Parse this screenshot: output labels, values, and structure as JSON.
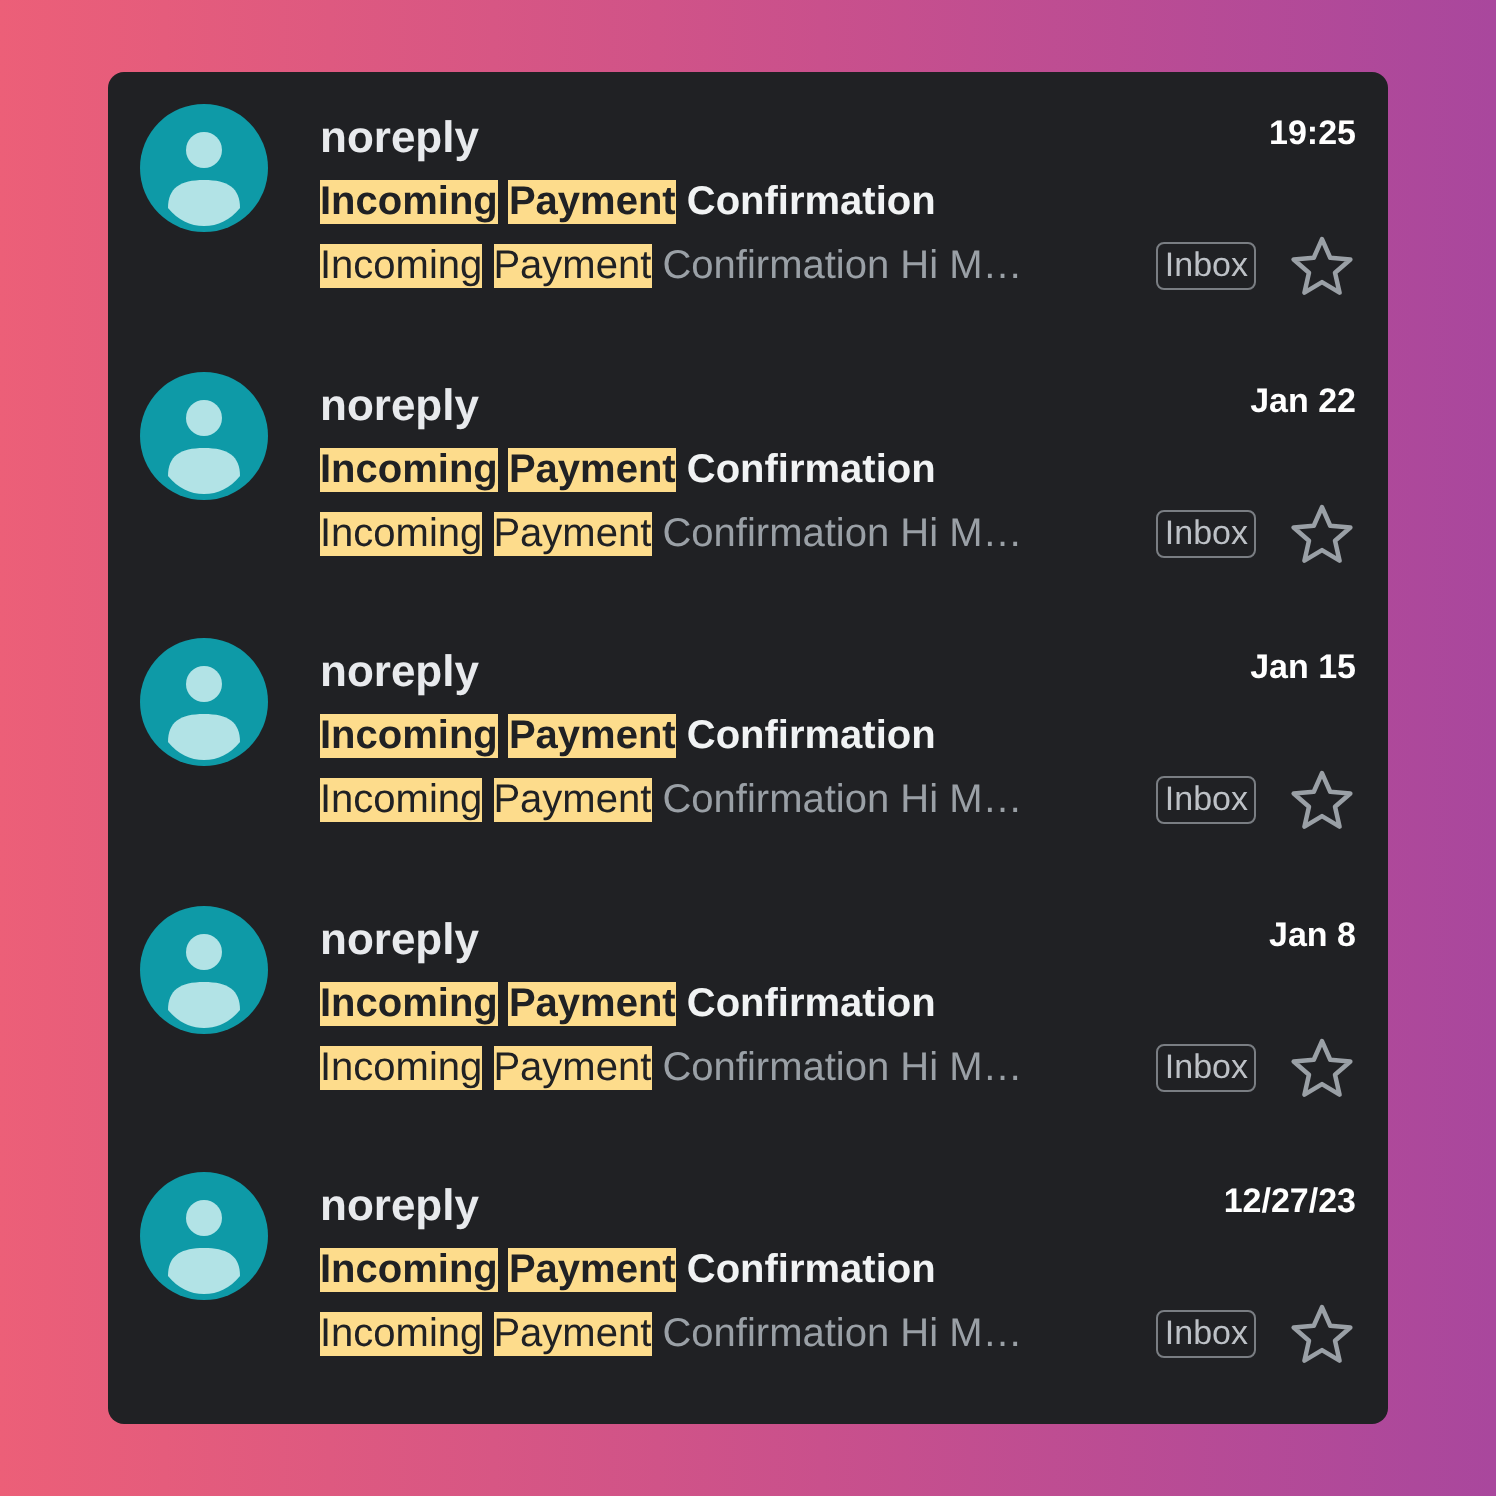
{
  "messages": [
    {
      "sender": "noreply",
      "time": "19:25",
      "subject": [
        {
          "text": "Incoming",
          "highlighted": true
        },
        {
          "text": "Payment",
          "highlighted": true
        },
        {
          "text": "Confirmation",
          "highlighted": false
        }
      ],
      "snippet": [
        {
          "text": "Incoming",
          "highlighted": true
        },
        {
          "text": "Payment",
          "highlighted": true
        },
        {
          "text": "Confirmation Hi M…",
          "highlighted": false
        }
      ],
      "label": "Inbox",
      "starred": false
    },
    {
      "sender": "noreply",
      "time": "Jan 22",
      "subject": [
        {
          "text": "Incoming",
          "highlighted": true
        },
        {
          "text": "Payment",
          "highlighted": true
        },
        {
          "text": "Confirmation",
          "highlighted": false
        }
      ],
      "snippet": [
        {
          "text": "Incoming",
          "highlighted": true
        },
        {
          "text": "Payment",
          "highlighted": true
        },
        {
          "text": "Confirmation Hi M…",
          "highlighted": false
        }
      ],
      "label": "Inbox",
      "starred": false
    },
    {
      "sender": "noreply",
      "time": "Jan 15",
      "subject": [
        {
          "text": "Incoming",
          "highlighted": true
        },
        {
          "text": "Payment",
          "highlighted": true
        },
        {
          "text": "Confirmation",
          "highlighted": false
        }
      ],
      "snippet": [
        {
          "text": "Incoming",
          "highlighted": true
        },
        {
          "text": "Payment",
          "highlighted": true
        },
        {
          "text": "Confirmation Hi M…",
          "highlighted": false
        }
      ],
      "label": "Inbox",
      "starred": false
    },
    {
      "sender": "noreply",
      "time": "Jan 8",
      "subject": [
        {
          "text": "Incoming",
          "highlighted": true
        },
        {
          "text": "Payment",
          "highlighted": true
        },
        {
          "text": "Confirmation",
          "highlighted": false
        }
      ],
      "snippet": [
        {
          "text": "Incoming",
          "highlighted": true
        },
        {
          "text": "Payment",
          "highlighted": true
        },
        {
          "text": "Confirmation Hi M…",
          "highlighted": false
        }
      ],
      "label": "Inbox",
      "starred": false
    },
    {
      "sender": "noreply",
      "time": "12/27/23",
      "subject": [
        {
          "text": "Incoming",
          "highlighted": true
        },
        {
          "text": "Payment",
          "highlighted": true
        },
        {
          "text": "Confirmation",
          "highlighted": false
        }
      ],
      "snippet": [
        {
          "text": "Incoming",
          "highlighted": true
        },
        {
          "text": "Payment",
          "highlighted": true
        },
        {
          "text": "Confirmation Hi M…",
          "highlighted": false
        }
      ],
      "label": "Inbox",
      "starred": false
    }
  ]
}
